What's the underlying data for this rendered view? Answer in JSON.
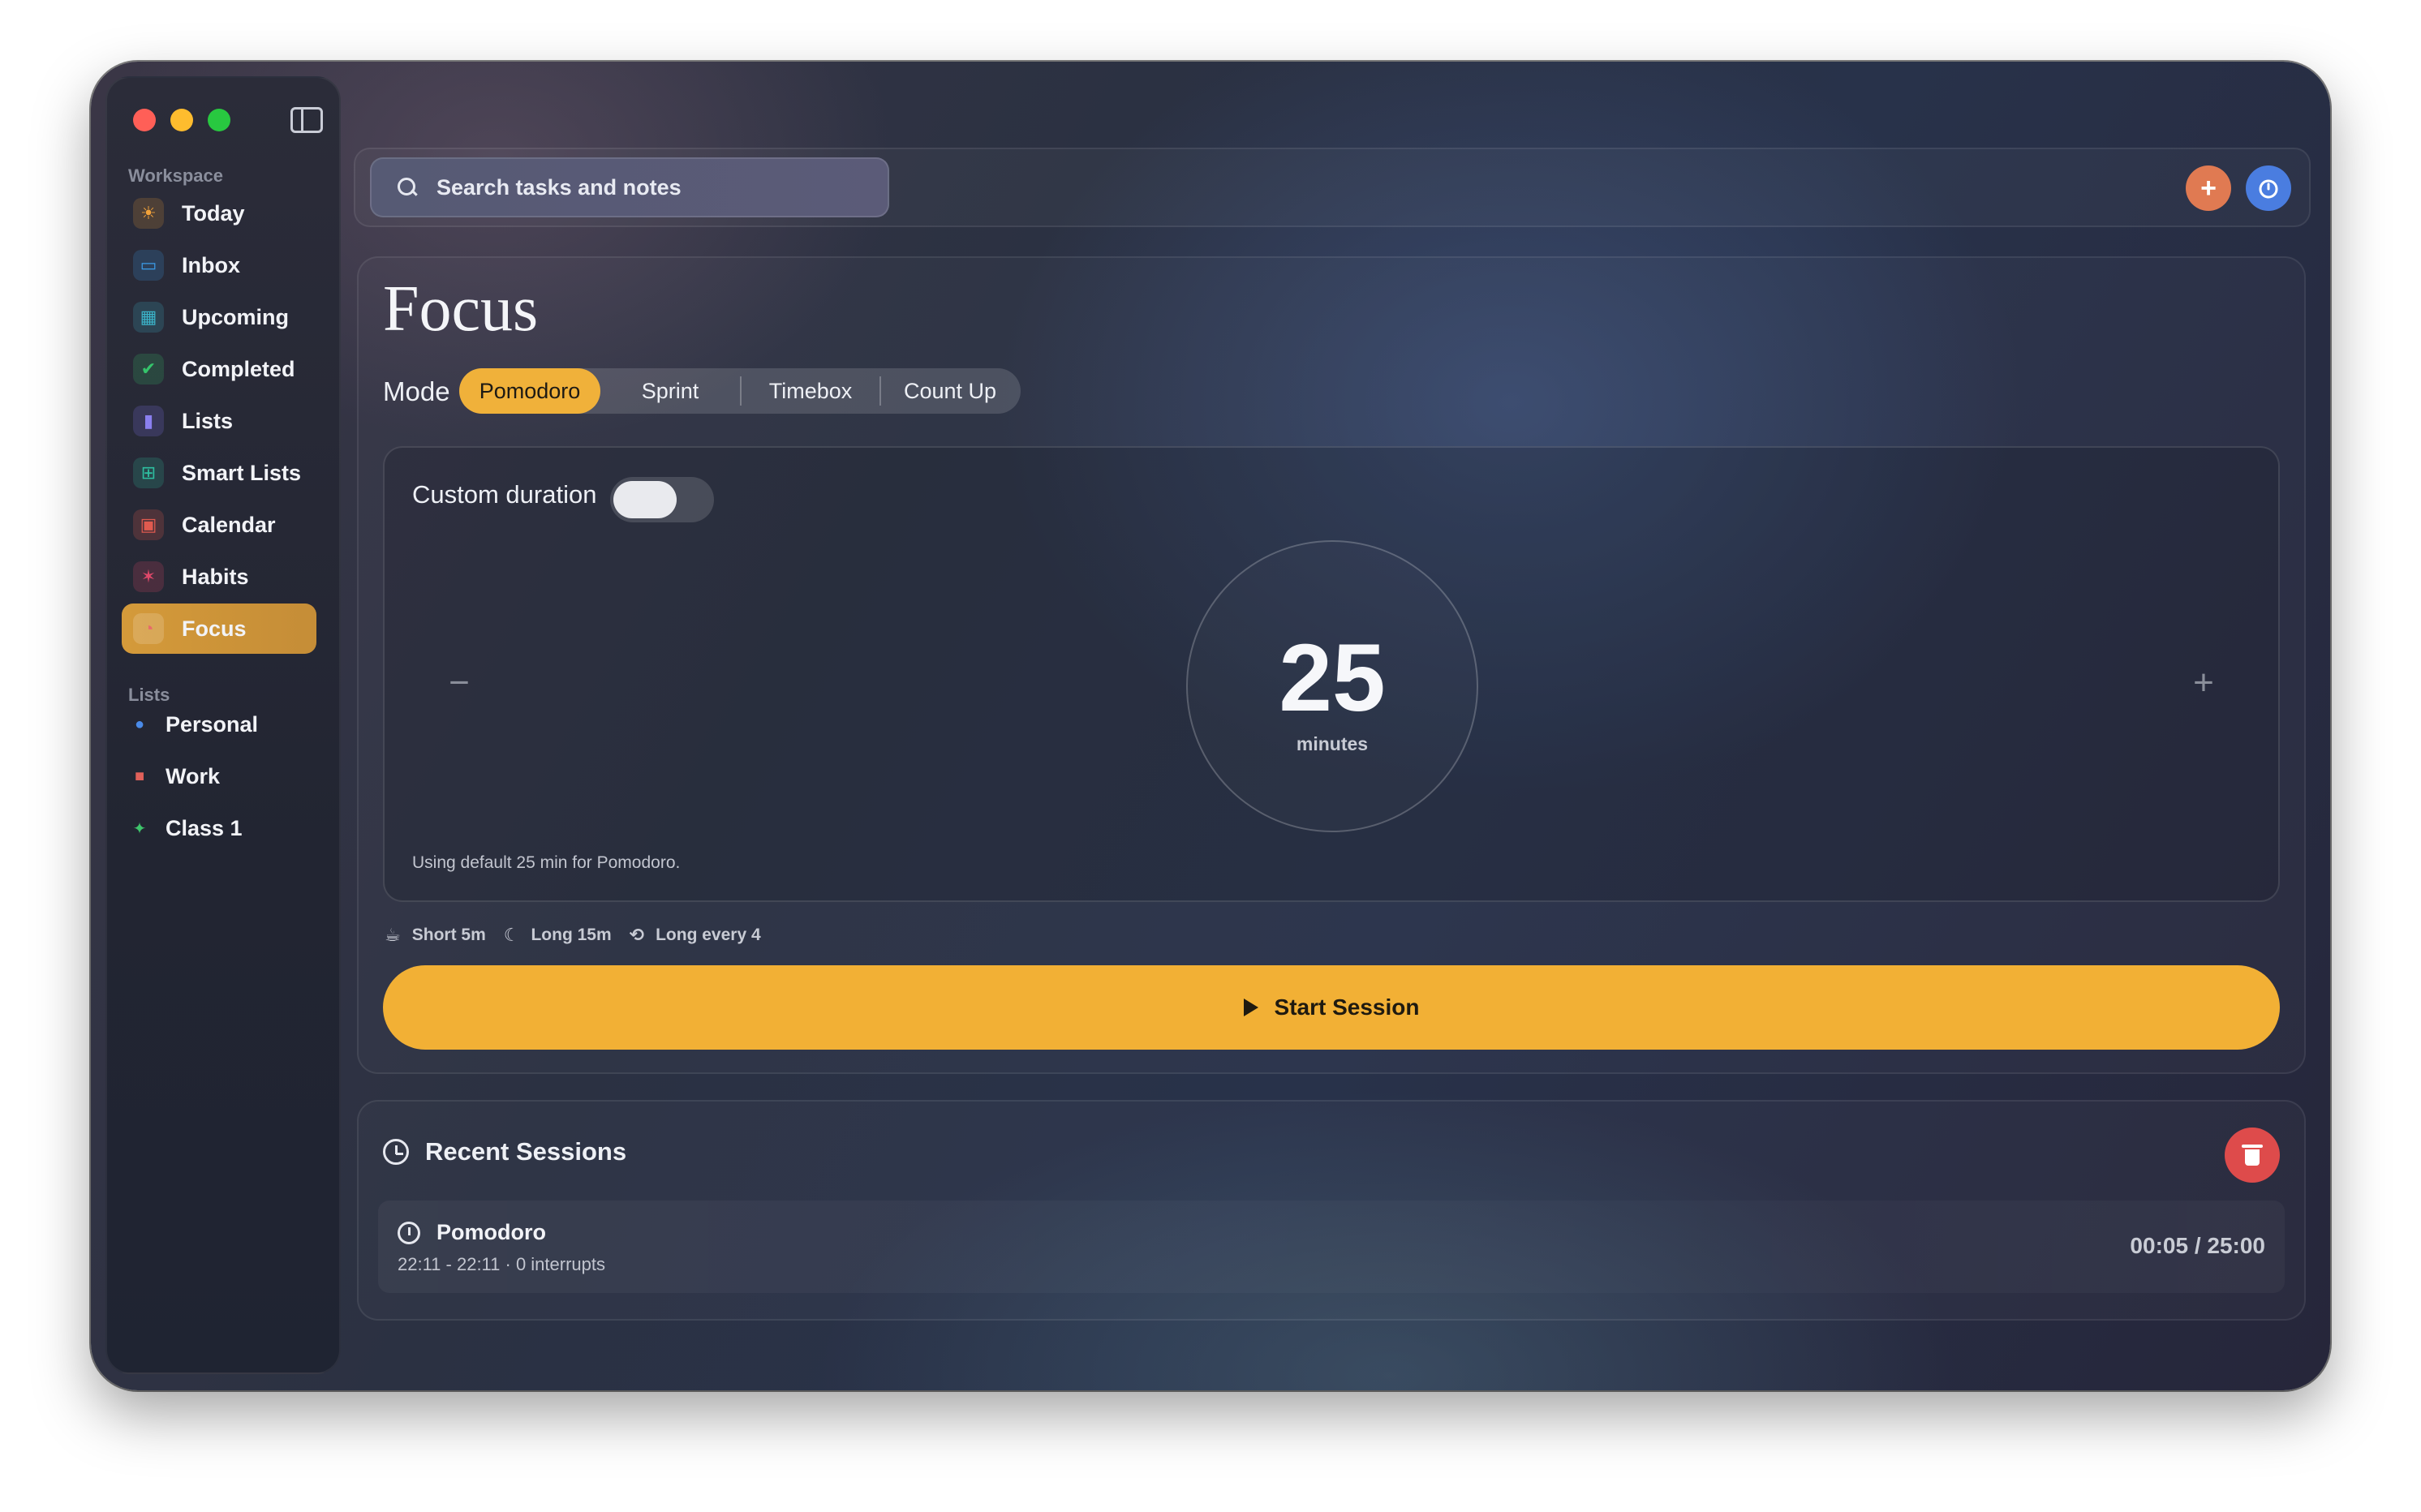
{
  "sidebar": {
    "workspace_label": "Workspace",
    "items": [
      {
        "label": "Today",
        "icon": "sun-icon",
        "color": "#f2a23a"
      },
      {
        "label": "Inbox",
        "icon": "inbox-tray-icon",
        "color": "#3b9be8"
      },
      {
        "label": "Upcoming",
        "icon": "calendar-clock-icon",
        "color": "#3bb3c9"
      },
      {
        "label": "Completed",
        "icon": "check-badge-icon",
        "color": "#35c46b"
      },
      {
        "label": "Lists",
        "icon": "list-book-icon",
        "color": "#7a6fe0"
      },
      {
        "label": "Smart Lists",
        "icon": "smart-list-icon",
        "color": "#2ebfa0"
      },
      {
        "label": "Calendar",
        "icon": "calendar-icon",
        "color": "#e05a4f"
      },
      {
        "label": "Habits",
        "icon": "habit-figure-icon",
        "color": "#e0486a"
      },
      {
        "label": "Focus",
        "icon": "focus-timer-icon",
        "color": "#e86a6a",
        "active": true
      }
    ],
    "lists_label": "Lists",
    "lists": [
      {
        "label": "Personal",
        "icon": "person-icon",
        "color": "#4a8ae8"
      },
      {
        "label": "Work",
        "icon": "briefcase-icon",
        "color": "#e0605a"
      },
      {
        "label": "Class 1",
        "icon": "sparkle-icon",
        "color": "#3ec46b"
      }
    ]
  },
  "topbar": {
    "search_placeholder": "Search tasks and notes",
    "add_button": "+",
    "add_color": "#e07a52",
    "timer_color": "#4a7de0"
  },
  "focus": {
    "title": "Focus",
    "mode_label": "Mode",
    "modes": [
      "Pomodoro",
      "Sprint",
      "Timebox",
      "Count Up"
    ],
    "selected_mode": "Pomodoro",
    "custom_duration_label": "Custom duration",
    "custom_duration_enabled": false,
    "duration_value": "25",
    "duration_unit": "minutes",
    "minus_label": "−",
    "plus_label": "+",
    "default_note": "Using default 25 min for Pomodoro.",
    "breaks": [
      {
        "label": "Short 5m",
        "icon": "coffee-cup-icon"
      },
      {
        "label": "Long 15m",
        "icon": "moon-icon"
      },
      {
        "label": "Long every 4",
        "icon": "repeat-icon"
      }
    ],
    "start_label": "Start Session",
    "accent_color": "#f2b035"
  },
  "recent": {
    "title": "Recent Sessions",
    "sessions": [
      {
        "name": "Pomodoro",
        "meta": "22:11 - 22:11 · 0 interrupts",
        "duration": "00:05 / 25:00"
      }
    ],
    "delete_color": "#de4b4b"
  }
}
